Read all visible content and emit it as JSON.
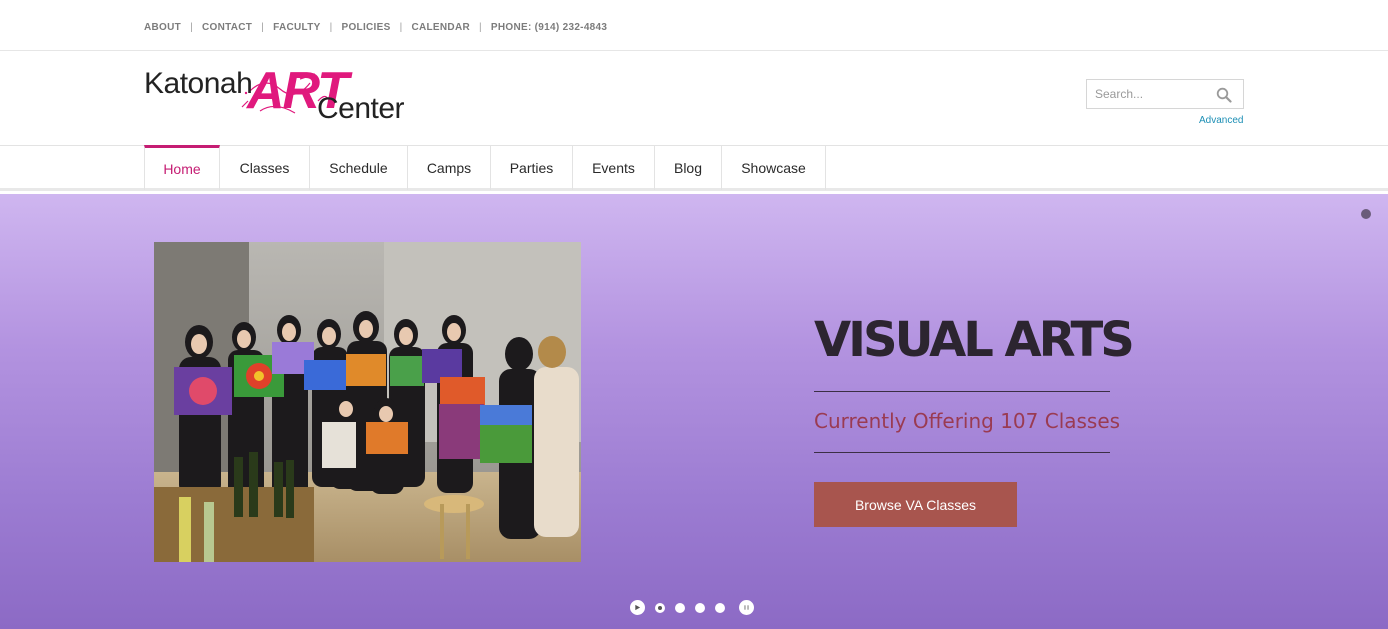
{
  "topbar": {
    "links": [
      "ABOUT",
      "CONTACT",
      "FACULTY",
      "POLICIES",
      "CALENDAR"
    ],
    "phone": "PHONE: (914) 232-4843"
  },
  "logo": {
    "part1": "Katonah",
    "part2": "ART",
    "part3": "Center",
    "accent_color": "#e0197d"
  },
  "search": {
    "placeholder": "Search...",
    "advanced_label": "Advanced"
  },
  "nav": {
    "items": [
      "Home",
      "Classes",
      "Schedule",
      "Camps",
      "Parties",
      "Events",
      "Blog",
      "Showcase"
    ],
    "active": "Home",
    "active_color": "#c51d73"
  },
  "hero": {
    "title": "VISUAL ARTS",
    "subtitle": "Currently Offering 107 Classes",
    "button_label": "Browse VA Classes",
    "button_color": "#a8554e",
    "slide_count": 4
  }
}
